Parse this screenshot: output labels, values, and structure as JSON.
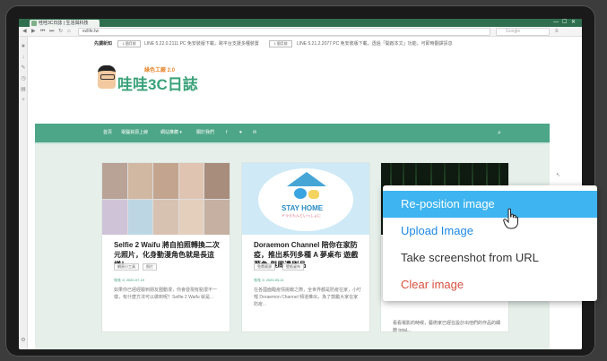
{
  "browser": {
    "tab_title": "哇哇3C日誌 | 生活與科技",
    "address": "ezlife.tw",
    "search_placeholder": "Google",
    "win_controls": [
      "—",
      "☐",
      "✕"
    ]
  },
  "ticker": {
    "label": "先讀新知",
    "badge1": "1 個月前",
    "text1": "LINE 5.22.0.2111 PC 免安裝版下載，跨平台支援多種裝置",
    "badge2": "1 個月前",
    "text2": "LINE 5.21.2.2077 PC 免安裝版下載，透過「開啟本文」功能，可即時翻譯訊息"
  },
  "site": {
    "logo_sub": "綠色工廠 2.0",
    "logo_main": "哇哇3C日誌",
    "nav": [
      "首頁",
      "電腦資源上線",
      "網站推薦 ▾",
      "關於我們",
      "f",
      "♥",
      "✉"
    ],
    "nav_search_icon": "search-icon"
  },
  "cards": [
    {
      "title": "Selfie 2 Waifu 將自拍照轉換二次元照片，化身動漫角色就是長這樣！",
      "tags": [
        "網頁小工具",
        "照片"
      ],
      "meta": "哇哇 ⊙ 2020-07-19",
      "excerpt": "如果你已經經驗到朋友圈動漫，你會發現有點很不一樣，有什麼方法可以做到呢？Selfie 2 Waifu 就是..."
    },
    {
      "title": "Doraemon Channel 陪你在家防疫，推出系列多種 A 夢桌布 遊戲 著色 與周邊刷品",
      "tags": [
        "免費資源",
        "壁紙桌布"
      ],
      "meta": "哇哇 ⊙ 2020-05-11",
      "excerpt": "在各國面臨疫情挑戰之際，全世界都是防疫在家，小叮噹 Doraemon Channel 頻道推出，為了鼓勵大家在家防疫..."
    },
    {
      "title": "",
      "tags": [],
      "meta": "",
      "excerpt": "看看電影的時候，藝術家已經在設計出他們的作品的細節 total..."
    }
  ],
  "stay_home": {
    "text": "STAY HOME",
    "sub": "ドラえもんといっしょに"
  },
  "context_menu": {
    "items": [
      "Re-position image",
      "Upload Image",
      "Take screenshot from URL",
      "Clear image"
    ],
    "colors": {
      "highlight": "#3eb4f0",
      "link": "#1e88e5",
      "danger": "#d9503f"
    }
  }
}
